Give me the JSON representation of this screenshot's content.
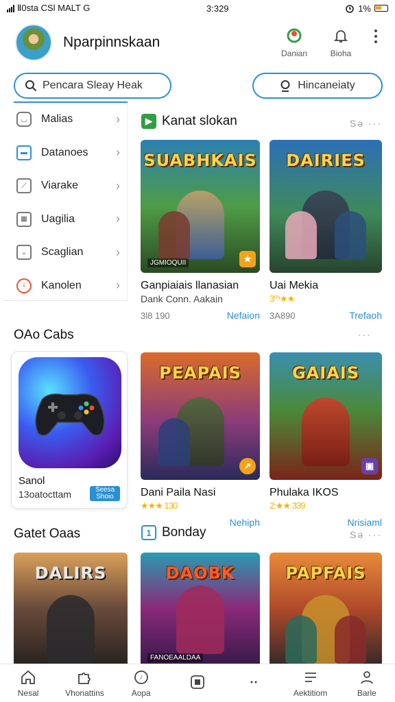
{
  "status": {
    "left_text": "Ⅱ0sta CSl MALT G",
    "time": "3:329",
    "battery": "1%"
  },
  "header": {
    "title": "Nparpinnskaan",
    "actions": [
      {
        "label": "Danian",
        "icon": "game-ring-icon"
      },
      {
        "label": "Bioha",
        "icon": "bell-icon"
      }
    ]
  },
  "search": {
    "value": "Pencara Sleay Heak",
    "filter_label": "Hincaneiaty"
  },
  "sidebar": {
    "items": [
      {
        "label": "Malias",
        "icon": "inbox-icon"
      },
      {
        "label": "Datanoes",
        "icon": "card-icon"
      },
      {
        "label": "Viarake",
        "icon": "chart-icon"
      },
      {
        "label": "Uagilia",
        "icon": "calendar-icon"
      },
      {
        "label": "Scaglian",
        "icon": "mail-icon"
      },
      {
        "label": "Kanolen",
        "icon": "info-icon"
      }
    ]
  },
  "sections": {
    "recommended": {
      "title": "Kanat slokan",
      "more": "Sə ···"
    },
    "oao": {
      "title": "OAo Cabs",
      "more": "···"
    },
    "gatet": {
      "title": "Gatet Oaas"
    },
    "bonday": {
      "title": "Bonday",
      "more": "Sə ···"
    }
  },
  "cards": {
    "c1": {
      "art_title": "SUABHKAIS",
      "art_sub": "JGMIOQUII",
      "name": "Ganpiaiais llanasian",
      "sub": "Dank Conn. Aakain",
      "count": "3l8 190",
      "link": "Nefaion"
    },
    "c2": {
      "art_title": "DAIRIES",
      "name": "Uai Mekia",
      "rating": "3⁰⁹★★",
      "count": "3A890",
      "link": "Trefaoh"
    },
    "c3": {
      "art_title": "PEAPAIS",
      "name": "Dani Paila Nasi",
      "rating": "★★★ 130",
      "link": "Nehiph"
    },
    "c4": {
      "art_title": "GAIAIS",
      "name": "Phulaka IKOS",
      "rating": "2:★★ 339",
      "link": "Nrisiaml"
    },
    "c5": {
      "art_title": "DALIRS"
    },
    "c6": {
      "art_title": "DAOBK",
      "art_sub": "FANOEAALDAA"
    },
    "c7": {
      "art_title": "PAPFAIS"
    }
  },
  "feature": {
    "name": "Sanol",
    "sub": "13oatocttam",
    "button": "Seesa Shoio"
  },
  "nav": [
    {
      "label": "Nesal",
      "icon": "home-icon"
    },
    {
      "label": "Vhonattins",
      "icon": "puzzle-icon"
    },
    {
      "label": "Aopa",
      "icon": "compass-icon"
    },
    {
      "label": "",
      "icon": "square-icon"
    },
    {
      "label": "",
      "icon": "dots-icon"
    },
    {
      "label": "Aektitiom",
      "icon": "list-icon"
    },
    {
      "label": "Barle",
      "icon": "person-icon"
    }
  ],
  "colors": {
    "accent": "#2a8fd4",
    "star": "#f4b400"
  }
}
